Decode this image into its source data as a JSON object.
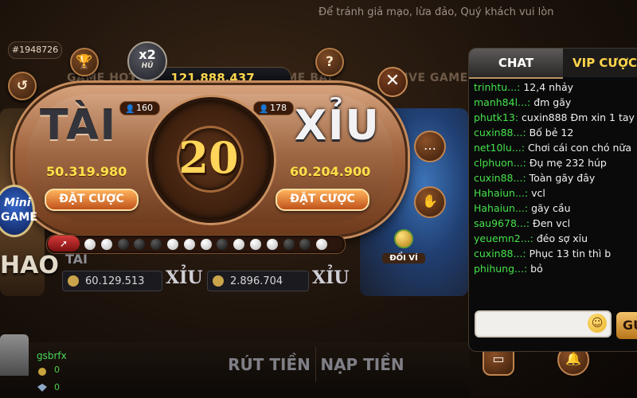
{
  "notice": "Để tránh giả mạo, lừa đảo, Quý khách vui lòn",
  "room_id": "#1948726",
  "bg_tabs": [
    "GAME HOT",
    "GAME BÀI",
    "LIVE GAME"
  ],
  "icons": {
    "history": "history-icon",
    "trophy": "trophy-icon",
    "help": "help-icon",
    "close": "close-icon",
    "chat": "chat-bubble-icon",
    "mute": "mute-hand-icon",
    "bell": "bell-icon",
    "wallet": "wallet-icon"
  },
  "jackpot": {
    "multiplier": "x2",
    "label": "HŨ",
    "amount": "121.888.437"
  },
  "tai": {
    "label": "TÀI",
    "players": "160",
    "total": "50.319.980",
    "bet_label": "ĐẶT CƯỢC"
  },
  "xiu": {
    "label": "XỈU",
    "players": "178",
    "total": "60.204.900",
    "bet_label": "ĐẶT CƯỢC"
  },
  "timer": "20",
  "history": [
    "white",
    "white",
    "black",
    "black",
    "black",
    "white",
    "white",
    "white",
    "black",
    "white",
    "white",
    "white",
    "black",
    "black",
    "white"
  ],
  "wallet_label": "ĐỔI VÍ",
  "minigame": {
    "line1": "Mini",
    "line2": "GAME"
  },
  "bg_rows": [
    {
      "value": "60.129.513",
      "label": "XỈU"
    },
    {
      "value": "2.896.704",
      "label": "XỈU"
    }
  ],
  "bg_labels": {
    "left": "HAO",
    "left_top": "TÀI"
  },
  "bottom": {
    "withdraw": "RÚT TIỀN",
    "deposit": "NẠP TIỀN"
  },
  "user": {
    "name": "gsbrfx",
    "balance1": "0",
    "balance2": "0"
  },
  "chat": {
    "tabs": [
      "CHAT",
      "VIP CƯỢC"
    ],
    "messages": [
      {
        "user": "trinhtu...:",
        "text": "12,4 nhảy"
      },
      {
        "user": "manh84l...:",
        "text": "đm gãy"
      },
      {
        "user": "phutk13:",
        "text": "cuxin888 Đm xin 1 tay"
      },
      {
        "user": "cuxin88...:",
        "text": "Bố bẻ 12"
      },
      {
        "user": "net10lu...:",
        "text": "Chơi cái con chó nữa"
      },
      {
        "user": "clphuon...:",
        "text": "Đụ mẹ 232 húp"
      },
      {
        "user": "cuxin88...:",
        "text": "Toàn gãy đây"
      },
      {
        "user": "Hahaiun...:",
        "text": "vcl"
      },
      {
        "user": "Hahaiun...:",
        "text": "gãy cầu"
      },
      {
        "user": "sau9678...:",
        "text": "Đen vcl"
      },
      {
        "user": "yeuemn2...:",
        "text": "đéo sợ xỉu"
      },
      {
        "user": "cuxin88...:",
        "text": "Phục 13 tin thì b"
      },
      {
        "user": "phihung...:",
        "text": "bỏ"
      }
    ],
    "send_label": "GỬ",
    "input_placeholder": ""
  }
}
